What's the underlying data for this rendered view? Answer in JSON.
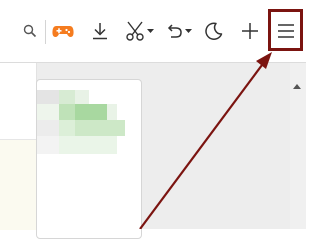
{
  "toolbar": {
    "buttons": [
      {
        "name": "search-icon",
        "interactable": true
      },
      {
        "name": "game-controller-icon",
        "interactable": true
      },
      {
        "name": "download-icon",
        "interactable": true
      },
      {
        "name": "scissors-icon",
        "interactable": true
      },
      {
        "name": "undo-icon",
        "interactable": true
      },
      {
        "name": "moon-icon",
        "interactable": true
      },
      {
        "name": "plus-icon",
        "interactable": true
      },
      {
        "name": "menu-icon",
        "interactable": true
      }
    ]
  },
  "colors": {
    "accent_orange": "#f57c1f",
    "annotation": "#7b1410",
    "icon": "#333333",
    "blur_green": "#a8d8a0"
  }
}
